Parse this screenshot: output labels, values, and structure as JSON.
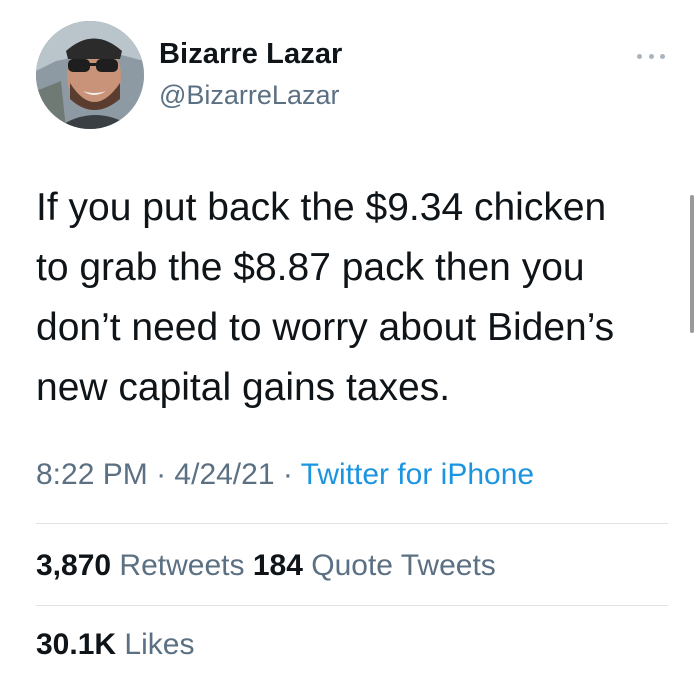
{
  "author": {
    "name": "Bizarre Lazar",
    "handle": "@BizarreLazar"
  },
  "tweet": {
    "lines": [
      "If you put back the $9.34 chicken",
      "to grab the $8.87 pack then you",
      "don’t need to worry about Biden’s",
      "new capital gains taxes."
    ]
  },
  "meta": {
    "time": "8:22 PM",
    "date": "4/24/21",
    "separator": "·",
    "source": "Twitter for iPhone"
  },
  "stats": {
    "retweets_count": "3,870",
    "retweets_label": "Retweets",
    "quotes_count": "184",
    "quotes_label": "Quote Tweets",
    "likes_count": "30.1K",
    "likes_label": "Likes"
  },
  "colors": {
    "text": "#0f1419",
    "secondary": "#5b7083",
    "link": "#1b95e0",
    "divider": "#dfe4e8"
  },
  "icons": {
    "more": "more-horizontal-icon"
  }
}
